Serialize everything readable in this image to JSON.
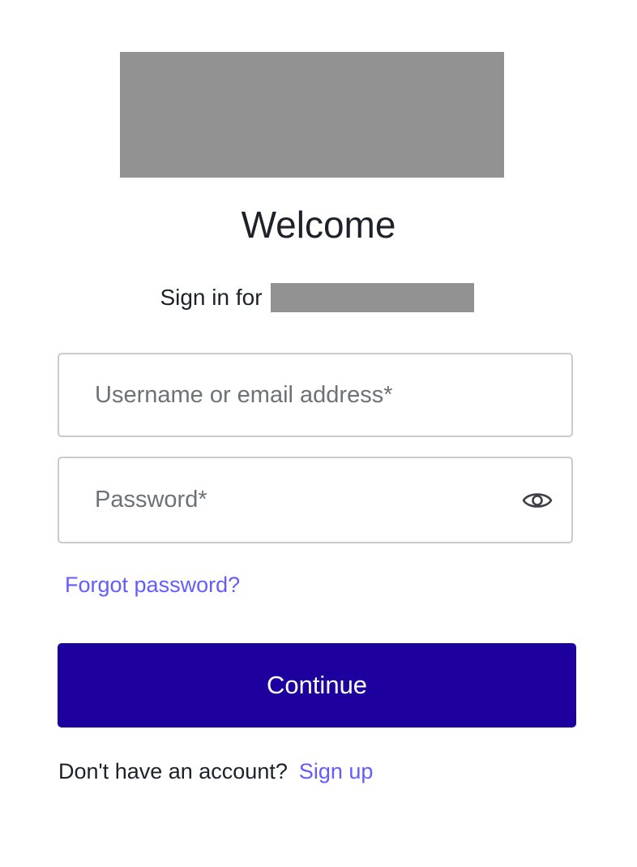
{
  "header": {
    "title": "Welcome",
    "subtitle": "Sign in for"
  },
  "form": {
    "username": {
      "placeholder": "Username or email address*",
      "value": ""
    },
    "password": {
      "placeholder": "Password*",
      "value": "",
      "toggle_icon": "eye-icon"
    },
    "forgot_password": "Forgot password?",
    "continue_label": "Continue"
  },
  "footer": {
    "prompt": "Don't have an account?",
    "signup_label": "Sign up"
  },
  "colors": {
    "primary": "#1e009f",
    "link": "#635dff",
    "text": "#1e212a",
    "border": "#c9cace",
    "redacted": "#929292"
  }
}
